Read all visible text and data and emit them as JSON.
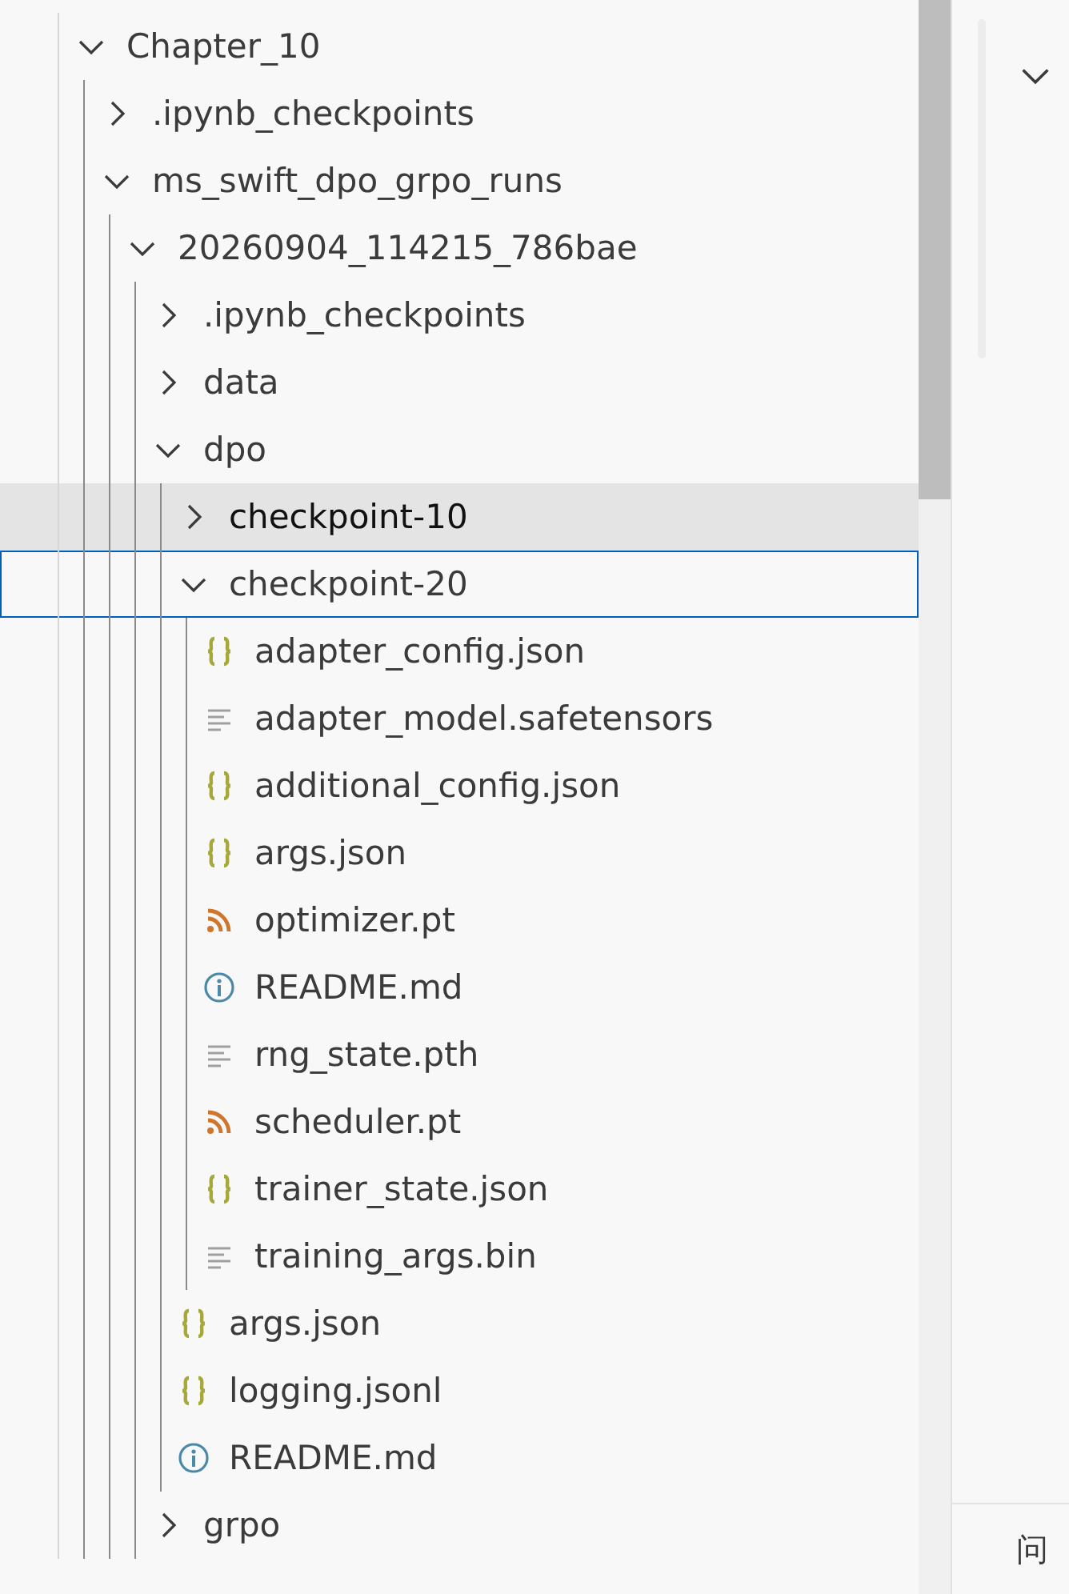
{
  "tree": [
    {
      "name": "Chapter_10",
      "kind": "folder",
      "expanded": true,
      "selected": false,
      "highlighted": false,
      "children": [
        {
          "name": ".ipynb_checkpoints",
          "kind": "folder",
          "expanded": false,
          "selected": false,
          "highlighted": false
        },
        {
          "name": "ms_swift_dpo_grpo_runs",
          "kind": "folder",
          "expanded": true,
          "selected": false,
          "highlighted": false,
          "children": [
            {
              "name": "20260904_114215_786bae",
              "kind": "folder",
              "expanded": true,
              "selected": false,
              "highlighted": false,
              "children": [
                {
                  "name": ".ipynb_checkpoints",
                  "kind": "folder",
                  "expanded": false,
                  "selected": false,
                  "highlighted": false
                },
                {
                  "name": "data",
                  "kind": "folder",
                  "expanded": false,
                  "selected": false,
                  "highlighted": false
                },
                {
                  "name": "dpo",
                  "kind": "folder",
                  "expanded": true,
                  "selected": false,
                  "highlighted": false,
                  "children": [
                    {
                      "name": "checkpoint-10",
                      "kind": "folder",
                      "expanded": false,
                      "selected": false,
                      "highlighted": true
                    },
                    {
                      "name": "checkpoint-20",
                      "kind": "folder",
                      "expanded": true,
                      "selected": true,
                      "highlighted": false,
                      "children": [
                        {
                          "name": "adapter_config.json",
                          "kind": "json",
                          "selected": false,
                          "highlighted": false
                        },
                        {
                          "name": "adapter_model.safetensors",
                          "kind": "text",
                          "selected": false,
                          "highlighted": false
                        },
                        {
                          "name": "additional_config.json",
                          "kind": "json",
                          "selected": false,
                          "highlighted": false
                        },
                        {
                          "name": "args.json",
                          "kind": "json",
                          "selected": false,
                          "highlighted": false
                        },
                        {
                          "name": "optimizer.pt",
                          "kind": "feed",
                          "selected": false,
                          "highlighted": false
                        },
                        {
                          "name": "README.md",
                          "kind": "info",
                          "selected": false,
                          "highlighted": false
                        },
                        {
                          "name": "rng_state.pth",
                          "kind": "text",
                          "selected": false,
                          "highlighted": false
                        },
                        {
                          "name": "scheduler.pt",
                          "kind": "feed",
                          "selected": false,
                          "highlighted": false
                        },
                        {
                          "name": "trainer_state.json",
                          "kind": "json",
                          "selected": false,
                          "highlighted": false
                        },
                        {
                          "name": "training_args.bin",
                          "kind": "text",
                          "selected": false,
                          "highlighted": false
                        }
                      ]
                    },
                    {
                      "name": "args.json",
                      "kind": "json",
                      "selected": false,
                      "highlighted": false
                    },
                    {
                      "name": "logging.jsonl",
                      "kind": "json",
                      "selected": false,
                      "highlighted": false
                    },
                    {
                      "name": "README.md",
                      "kind": "info",
                      "selected": false,
                      "highlighted": false
                    }
                  ]
                },
                {
                  "name": "grpo",
                  "kind": "folder",
                  "expanded": false,
                  "selected": false,
                  "highlighted": false
                }
              ]
            }
          ]
        }
      ]
    }
  ],
  "panel": {
    "tab_label": "问"
  }
}
